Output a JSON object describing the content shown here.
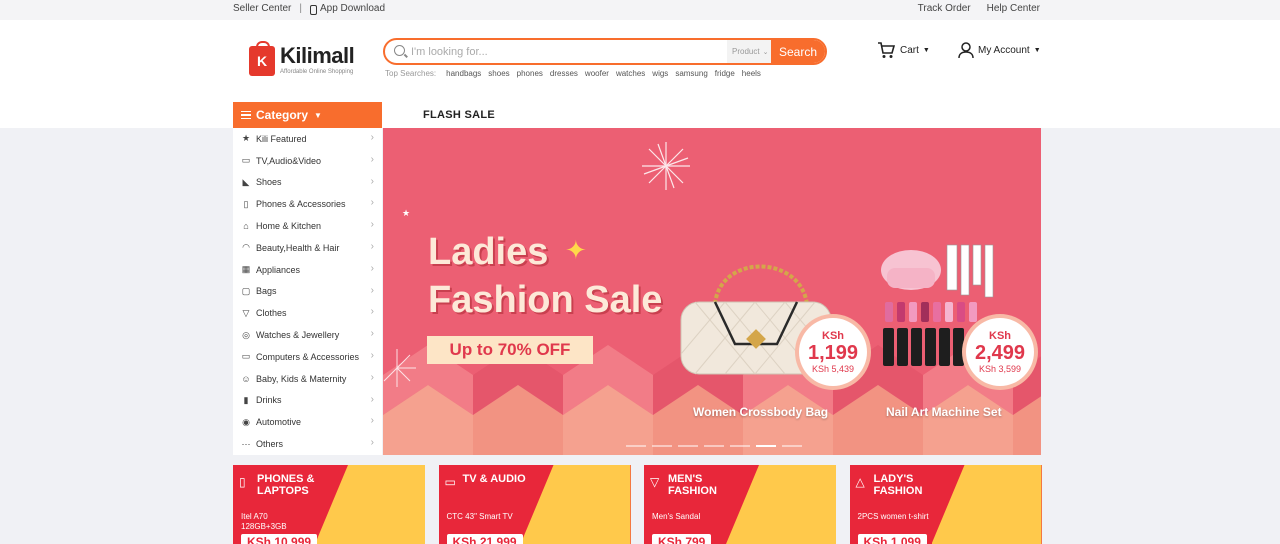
{
  "topbar": {
    "seller_center": "Seller Center",
    "separator": "|",
    "app_download": "App Download",
    "track_order": "Track Order",
    "help_center": "Help Center"
  },
  "logo": {
    "letter": "K",
    "name": "Kilimall",
    "tagline": "Affordable Online Shopping"
  },
  "search": {
    "placeholder": "I'm looking for...",
    "scope": "Product",
    "button": "Search",
    "top_label": "Top Searches:",
    "top_terms": [
      "handbags",
      "shoes",
      "phones",
      "dresses",
      "woofer",
      "watches",
      "wigs",
      "samsung",
      "fridge",
      "heels"
    ]
  },
  "cart_label": "Cart",
  "account_label": "My Account",
  "category_label": "Category",
  "flash_sale_label": "FLASH SALE",
  "menu": [
    {
      "label": "Kili Featured",
      "icon": "star-icon"
    },
    {
      "label": "TV,Audio&Video",
      "icon": "tv-icon"
    },
    {
      "label": "Shoes",
      "icon": "shoe-icon"
    },
    {
      "label": "Phones & Accessories",
      "icon": "phone-icon"
    },
    {
      "label": "Home & Kitchen",
      "icon": "home-icon"
    },
    {
      "label": "Beauty,Health & Hair",
      "icon": "headset-icon"
    },
    {
      "label": "Appliances",
      "icon": "appliance-icon"
    },
    {
      "label": "Bags",
      "icon": "bag-icon"
    },
    {
      "label": "Clothes",
      "icon": "shirt-icon"
    },
    {
      "label": "Watches & Jewellery",
      "icon": "watch-icon"
    },
    {
      "label": "Computers & Accessories",
      "icon": "laptop-icon"
    },
    {
      "label": "Baby, Kids & Maternity",
      "icon": "baby-icon"
    },
    {
      "label": "Drinks",
      "icon": "bottle-icon"
    },
    {
      "label": "Automotive",
      "icon": "car-icon"
    },
    {
      "label": "Others",
      "icon": "more-icon"
    }
  ],
  "banner": {
    "line1": "Ladies",
    "line2": "Fashion Sale",
    "promo": "Up to 70% OFF",
    "products": [
      {
        "name": "Women Crossbody Bag",
        "currency": "KSh",
        "price": "1,199",
        "old_price": "KSh 5,439"
      },
      {
        "name": "Nail Art Machine Set",
        "currency": "KSh",
        "price": "2,499",
        "old_price": "KSh 3,599"
      }
    ],
    "slide_count": 7,
    "active_slide": 6,
    "colors": {
      "background": "#ec5f73",
      "accent": "#fde5c6"
    }
  },
  "cards": [
    {
      "title": "PHONES & LAPTOPS",
      "icon": "phone-icon",
      "subtitle1": "Itel A70",
      "subtitle2": "128GB+3GB",
      "price": "KSh 10,999"
    },
    {
      "title": "TV & AUDIO",
      "icon": "tv-icon",
      "subtitle1": "CTC 43\" Smart TV",
      "subtitle2": "",
      "price": "KSh 21,999"
    },
    {
      "title": "MEN'S FASHION",
      "icon": "shirt-icon",
      "subtitle1": "Men's Sandal",
      "subtitle2": "",
      "price": "KSh 799"
    },
    {
      "title": "LADY'S FASHION",
      "icon": "dress-icon",
      "subtitle1": "2PCS women t-shirt",
      "subtitle2": "",
      "price": "KSh 1,099"
    }
  ],
  "colors": {
    "brand_orange": "#f86d2d",
    "brand_red": "#e5392c",
    "card_red": "#e8273a",
    "card_yellow": "#ffc94b"
  }
}
